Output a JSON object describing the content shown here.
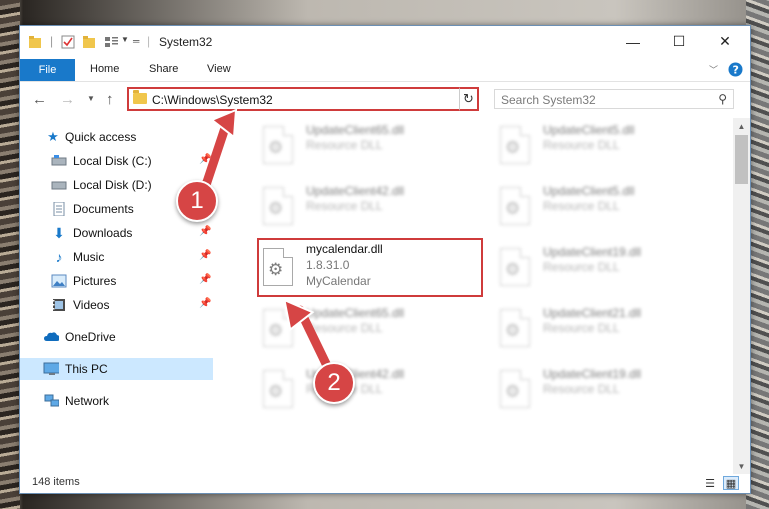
{
  "window": {
    "title": "System32",
    "minimize_glyph": "—",
    "maximize_glyph": "☐",
    "close_glyph": "✕"
  },
  "ribbon": {
    "tabs": [
      {
        "label": "File",
        "active": true
      },
      {
        "label": "Home"
      },
      {
        "label": "Share"
      },
      {
        "label": "View"
      }
    ]
  },
  "address": {
    "path": "C:\\Windows\\System32",
    "search_placeholder": "Search System32"
  },
  "nav": {
    "items": [
      {
        "label": "Quick access",
        "icon": "star-icon",
        "pinned": false
      },
      {
        "label": "Local Disk (C:)",
        "icon": "drive-icon",
        "pinned": true
      },
      {
        "label": "Local Disk (D:)",
        "icon": "drive-icon",
        "pinned": true
      },
      {
        "label": "Documents",
        "icon": "document-icon",
        "pinned": true
      },
      {
        "label": "Downloads",
        "icon": "download-icon",
        "pinned": true
      },
      {
        "label": "Music",
        "icon": "music-icon",
        "pinned": true
      },
      {
        "label": "Pictures",
        "icon": "pictures-icon",
        "pinned": true
      },
      {
        "label": "Videos",
        "icon": "video-icon",
        "pinned": true
      },
      {
        "label": "OneDrive",
        "icon": "cloud-icon",
        "pinned": false
      },
      {
        "label": "This PC",
        "icon": "computer-icon",
        "pinned": false,
        "selected": true
      },
      {
        "label": "Network",
        "icon": "network-icon",
        "pinned": false
      }
    ]
  },
  "files": [
    {
      "name": "UpdateClient65.dll",
      "line2": "Resource DLL",
      "blurred": true
    },
    {
      "name": "UpdateClient5.dll",
      "line2": "Resource DLL",
      "blurred": true
    },
    {
      "name": "UpdateClient42.dll",
      "line2": "Resource DLL",
      "blurred": true
    },
    {
      "name": "UpdateClient5.dll",
      "line2": "Resource DLL",
      "blurred": true
    },
    {
      "name": "mycalendar.dll",
      "line2": "1.8.31.0",
      "line3": "MyCalendar",
      "blurred": false,
      "highlighted": true
    },
    {
      "name": "UpdateClient19.dll",
      "line2": "Resource DLL",
      "blurred": true
    },
    {
      "name": "UpdateClient65.dll",
      "line2": "Resource DLL",
      "blurred": true
    },
    {
      "name": "UpdateClient21.dll",
      "line2": "Resource DLL",
      "blurred": true
    },
    {
      "name": "UpdateClient42.dll",
      "line2": "Resource DLL",
      "blurred": true
    },
    {
      "name": "UpdateClient19.dll",
      "line2": "Resource DLL",
      "blurred": true
    }
  ],
  "status": {
    "item_count": "148 items"
  },
  "annotations": [
    {
      "number": "1",
      "color": "#d64545"
    },
    {
      "number": "2",
      "color": "#d64545"
    }
  ],
  "colors": {
    "accent": "#1979ca",
    "highlight_border": "#cf3b3b",
    "selection": "#cce8ff"
  }
}
